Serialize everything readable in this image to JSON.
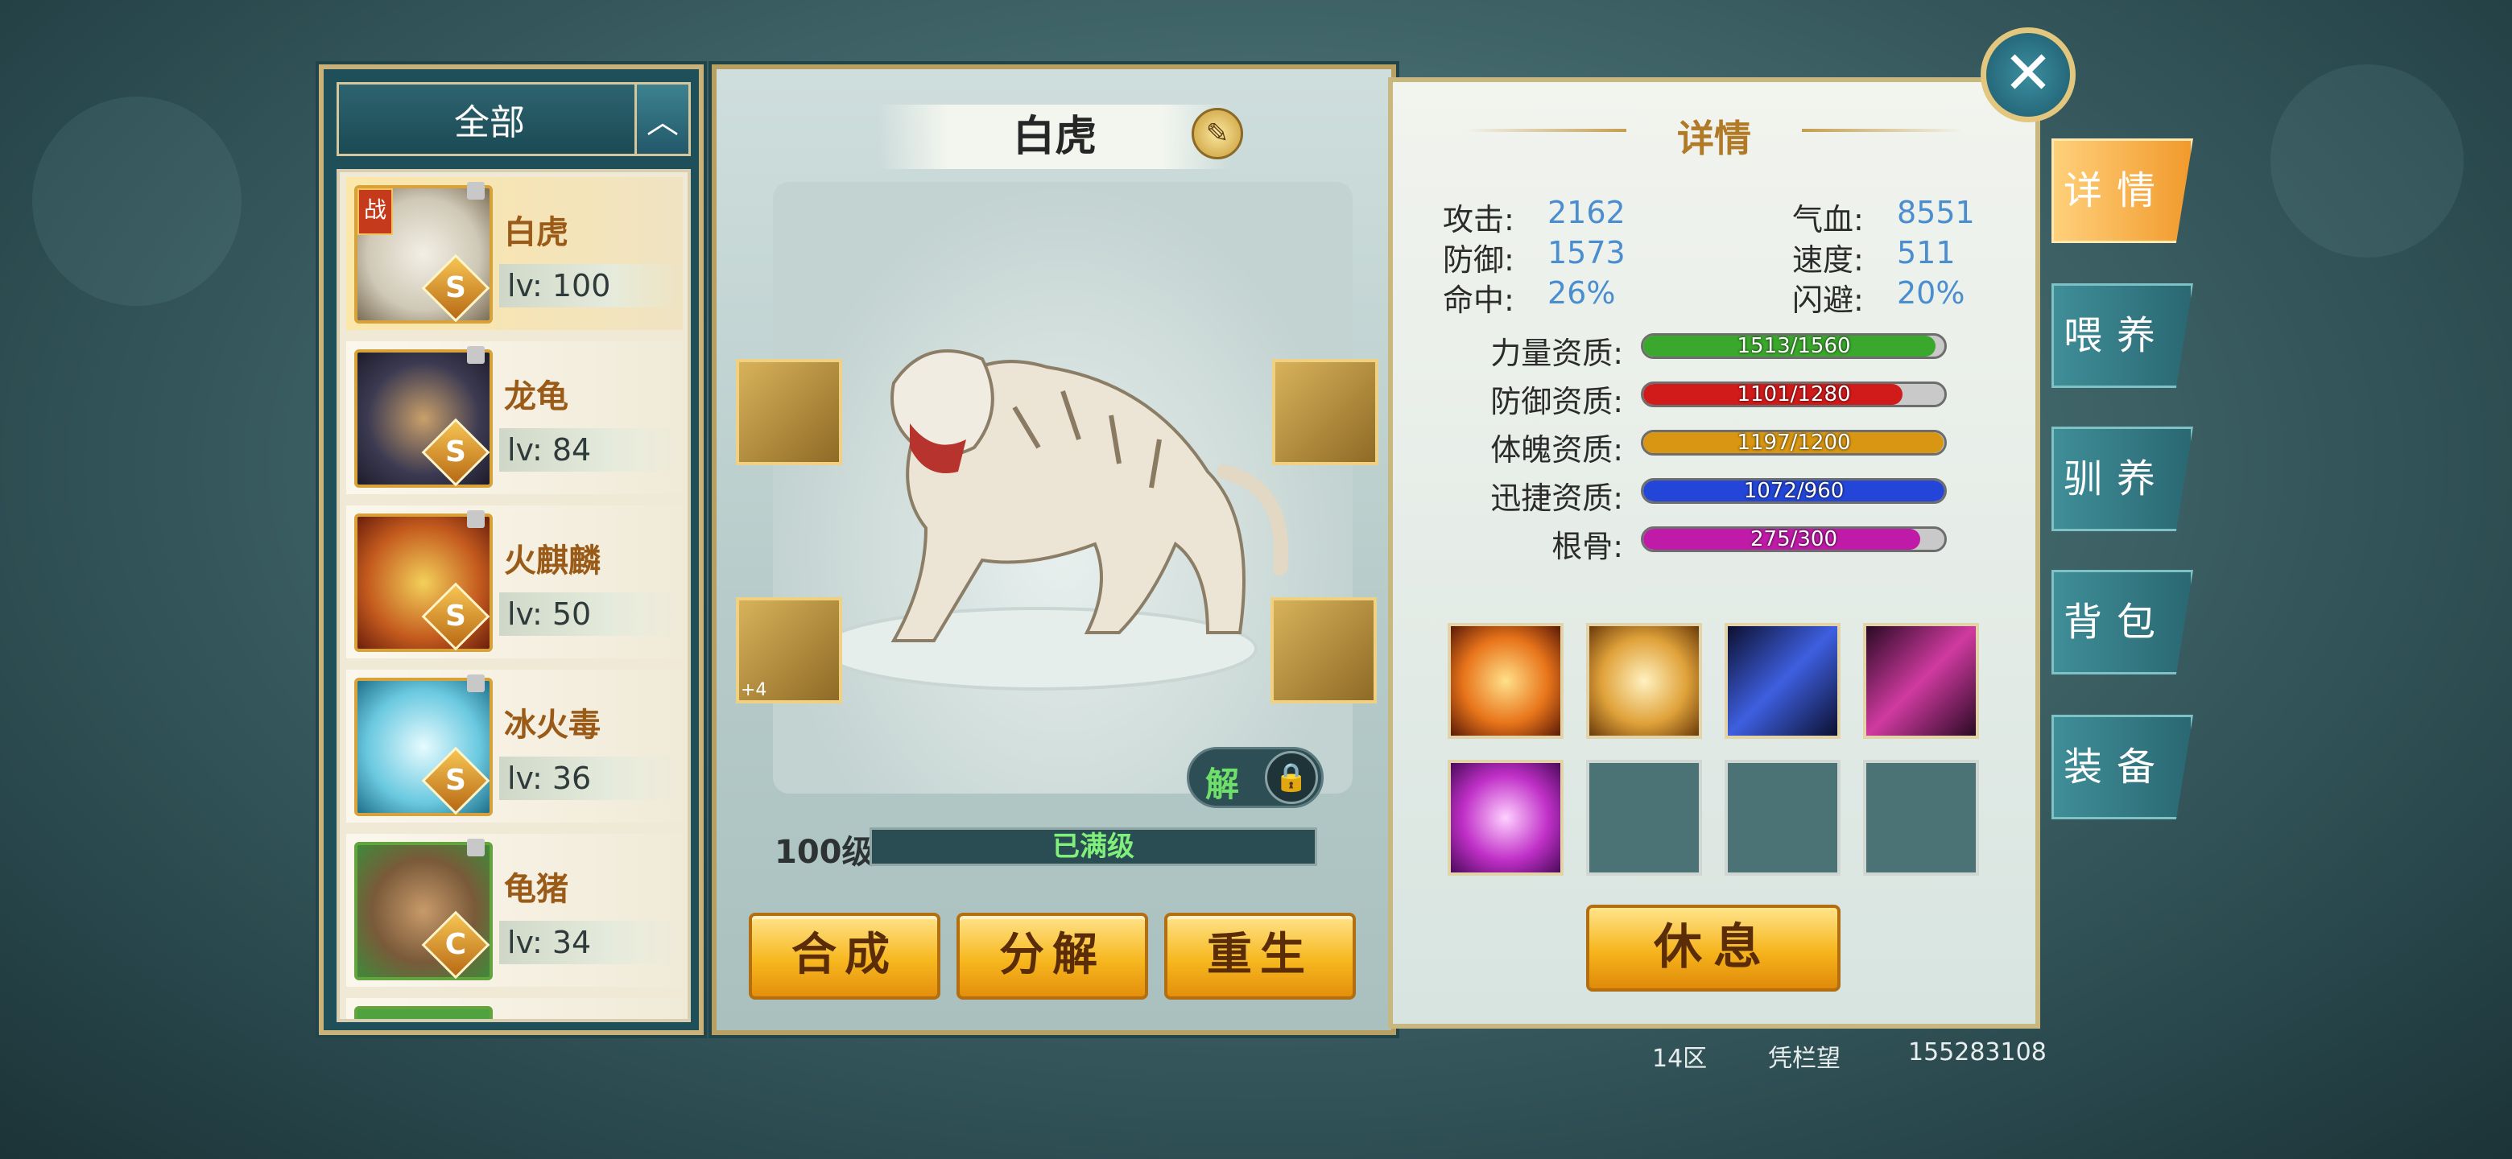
{
  "filter": {
    "label": "全部",
    "toggle_icon": "chevron-up-icon"
  },
  "pets": [
    {
      "name": "白虎",
      "level": "lv: 100",
      "grade": "S",
      "battle_tag": "战",
      "selected": true,
      "color": "#cfc8b6"
    },
    {
      "name": "龙龟",
      "level": "lv: 84",
      "grade": "S",
      "color": "#3c3a52"
    },
    {
      "name": "火麒麟",
      "level": "lv: 50",
      "grade": "S",
      "color": "#c45b1e"
    },
    {
      "name": "冰火毒",
      "level": "lv: 36",
      "grade": "S",
      "color": "#6ac9e0"
    },
    {
      "name": "龟猪",
      "level": "lv: 34",
      "grade": "C",
      "color": "#7a5a3a"
    }
  ],
  "center": {
    "pet_name": "白虎",
    "unlock_label": "解",
    "level_label": "100级",
    "level_status": "已满级",
    "buttons": {
      "compose": "合成",
      "decompose": "分解",
      "rebirth": "重生"
    },
    "equip_plus": "+4"
  },
  "detail": {
    "title": "详情",
    "stats": {
      "attack_label": "攻击:",
      "attack": "2162",
      "defense_label": "防御:",
      "defense": "1573",
      "hit_label": "命中:",
      "hit": "26%",
      "hp_label": "气血:",
      "hp": "8551",
      "speed_label": "速度:",
      "speed": "511",
      "dodge_label": "闪避:",
      "dodge": "20%"
    },
    "aptitudes": [
      {
        "label": "力量资质:",
        "text": "1513/1560",
        "fill": 0.97,
        "color": "#3aa82c"
      },
      {
        "label": "防御资质:",
        "text": "1101/1280",
        "fill": 0.86,
        "color": "#d11a1a"
      },
      {
        "label": "体魄资质:",
        "text": "1197/1200",
        "fill": 0.998,
        "color": "#d89612"
      },
      {
        "label": "迅捷资质:",
        "text": "1072/960",
        "fill": 1.0,
        "color": "#2346d8"
      },
      {
        "label": "根骨:",
        "text": "275/300",
        "fill": 0.92,
        "color": "#c01aa8"
      }
    ],
    "skills": [
      {
        "name": "fire-phoenix-skill-icon",
        "color": "#e8741a"
      },
      {
        "name": "golden-lion-skill-icon",
        "color": "#e0a23a"
      },
      {
        "name": "blue-claw-skill-icon",
        "color": "#3e5fe0"
      },
      {
        "name": "pink-claw-skill-icon",
        "color": "#d03aa0"
      },
      {
        "name": "purple-lightning-skill-icon",
        "color": "#c030c8"
      },
      {
        "name": "empty-skill-slot",
        "color": ""
      },
      {
        "name": "empty-skill-slot",
        "color": ""
      },
      {
        "name": "empty-skill-slot",
        "color": ""
      }
    ],
    "rest_button": "休息"
  },
  "tabs": [
    "详情",
    "喂养",
    "驯养",
    "背包",
    "装备"
  ],
  "footer": {
    "server": "14区",
    "player": "凭栏望",
    "id": "155283108"
  }
}
